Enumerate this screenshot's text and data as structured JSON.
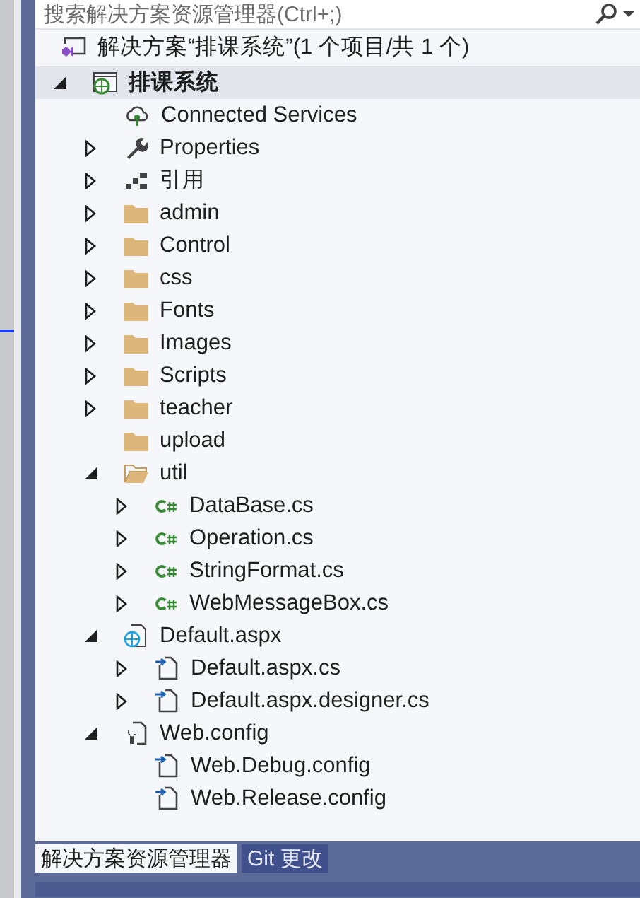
{
  "search": {
    "placeholder": "搜索解决方案资源管理器(Ctrl+;)"
  },
  "solution": {
    "label": "解决方案“排课系统”(1 个项目/共 1 个)"
  },
  "tree": [
    {
      "label": "排课系统",
      "kind": "project",
      "expandable": true,
      "expanded": true,
      "selected": true,
      "children": [
        {
          "label": "Connected Services",
          "kind": "cloud",
          "expandable": false,
          "selected": false
        },
        {
          "label": "Properties",
          "kind": "wrench",
          "expandable": true,
          "expanded": false,
          "selected": false
        },
        {
          "label": "引用",
          "kind": "references",
          "expandable": true,
          "expanded": false,
          "selected": false
        },
        {
          "label": "admin",
          "kind": "folder",
          "expandable": true,
          "expanded": false,
          "selected": false
        },
        {
          "label": "Control",
          "kind": "folder",
          "expandable": true,
          "expanded": false,
          "selected": false
        },
        {
          "label": "css",
          "kind": "folder",
          "expandable": true,
          "expanded": false,
          "selected": false
        },
        {
          "label": "Fonts",
          "kind": "folder",
          "expandable": true,
          "expanded": false,
          "selected": false
        },
        {
          "label": "Images",
          "kind": "folder",
          "expandable": true,
          "expanded": false,
          "selected": false
        },
        {
          "label": "Scripts",
          "kind": "folder",
          "expandable": true,
          "expanded": false,
          "selected": false
        },
        {
          "label": "teacher",
          "kind": "folder",
          "expandable": true,
          "expanded": false,
          "selected": false
        },
        {
          "label": "upload",
          "kind": "folder",
          "expandable": false,
          "selected": false
        },
        {
          "label": "util",
          "kind": "folder-open",
          "expandable": true,
          "expanded": true,
          "selected": false,
          "children": [
            {
              "label": "DataBase.cs",
              "kind": "csharp",
              "expandable": true,
              "expanded": false,
              "selected": false
            },
            {
              "label": "Operation.cs",
              "kind": "csharp",
              "expandable": true,
              "expanded": false,
              "selected": false
            },
            {
              "label": "StringFormat.cs",
              "kind": "csharp",
              "expandable": true,
              "expanded": false,
              "selected": false
            },
            {
              "label": "WebMessageBox.cs",
              "kind": "csharp",
              "expandable": true,
              "expanded": false,
              "selected": false
            }
          ]
        },
        {
          "label": "Default.aspx",
          "kind": "web-page",
          "expandable": true,
          "expanded": true,
          "selected": false,
          "children": [
            {
              "label": "Default.aspx.cs",
              "kind": "code-file",
              "expandable": true,
              "expanded": false,
              "selected": false
            },
            {
              "label": "Default.aspx.designer.cs",
              "kind": "code-file",
              "expandable": true,
              "expanded": false,
              "selected": false
            }
          ]
        },
        {
          "label": "Web.config",
          "kind": "config",
          "expandable": true,
          "expanded": true,
          "selected": false,
          "children": [
            {
              "label": "Web.Debug.config",
              "kind": "code-file",
              "expandable": false,
              "selected": false
            },
            {
              "label": "Web.Release.config",
              "kind": "code-file",
              "expandable": false,
              "selected": false
            }
          ]
        }
      ]
    }
  ],
  "tabs": [
    {
      "label": "解决方案资源管理器",
      "selected": true
    },
    {
      "label": "Git 更改",
      "selected": false
    }
  ]
}
